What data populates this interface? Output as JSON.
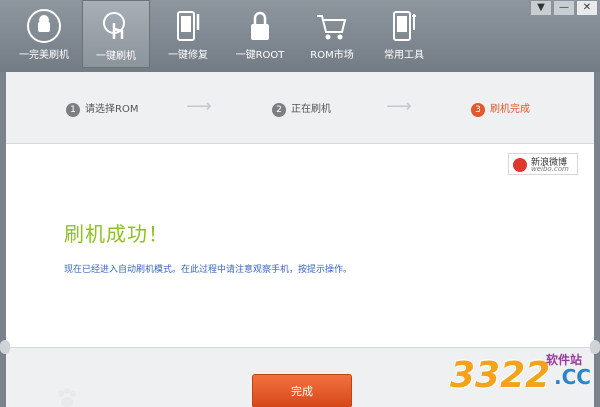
{
  "toolbar": {
    "items": [
      {
        "label": "一完美刷机",
        "icon": "android-robot-icon"
      },
      {
        "label": "一键刷机",
        "icon": "touch-click-icon"
      },
      {
        "label": "一键修复",
        "icon": "phone-wrench-icon"
      },
      {
        "label": "一键ROOT",
        "icon": "padlock-icon"
      },
      {
        "label": "ROM市场",
        "icon": "shopping-cart-icon"
      },
      {
        "label": "常用工具",
        "icon": "phone-tools-icon"
      }
    ],
    "window_controls": {
      "dropdown": "▼",
      "minimize": "—",
      "close": "✕"
    }
  },
  "steps": [
    {
      "num": "1",
      "label": "请选择ROM"
    },
    {
      "num": "2",
      "label": "正在刷机"
    },
    {
      "num": "3",
      "label": "刷机完成"
    }
  ],
  "weibo": {
    "line1": "新浪微博",
    "line2": "weibo.com"
  },
  "main": {
    "title": "刷机成功！",
    "description": "现在已经进入自动刷机模式。在此过程中请注意观察手机，按提示操作。"
  },
  "footer": {
    "finish_button": "完成"
  },
  "watermark": {
    "number": "3322",
    "site_label": "软件站",
    "domain": ".CC"
  },
  "colors": {
    "accent_orange": "#e2582d",
    "success_green": "#8dc21f",
    "link_blue": "#3a67c2"
  }
}
